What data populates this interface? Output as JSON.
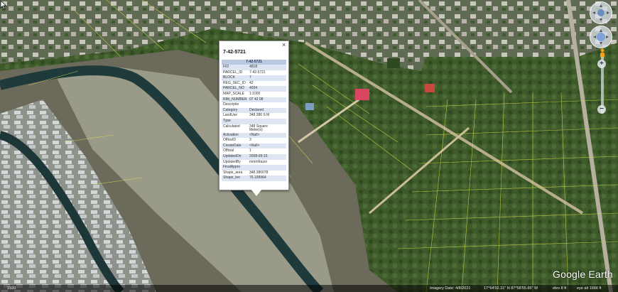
{
  "popup": {
    "title": "7-42-5721",
    "close": "×",
    "header": "7-42-5721",
    "rows": [
      {
        "k": "FID",
        "v": "4818"
      },
      {
        "k": "PARCEL_ID",
        "v": "7-42-5721"
      },
      {
        "k": "BLOCK",
        "v": "7"
      },
      {
        "k": "REG_SEC_ID",
        "v": "42"
      },
      {
        "k": "PARCEL_NO",
        "v": "4034"
      },
      {
        "k": "MAP_SCALE",
        "v": "1:1000"
      },
      {
        "k": "RIM_NUMBER",
        "v": "07 42 08"
      },
      {
        "k": "Descriptio",
        "v": ""
      },
      {
        "k": "Category",
        "v": "Declared"
      },
      {
        "k": "LandUse",
        "v": "348.386 S M"
      },
      {
        "k": "Type",
        "v": ""
      },
      {
        "k": "Calculated",
        "v": "348 Square\nMeter(s)"
      },
      {
        "k": "Activation",
        "v": "<Null>"
      },
      {
        "k": "OfficeID",
        "v": "3"
      },
      {
        "k": "CreateDate",
        "v": "<Null>"
      },
      {
        "k": "Official",
        "v": "1"
      },
      {
        "k": "UpdatedOn",
        "v": "2008-09-15"
      },
      {
        "k": "UpdatedBy",
        "v": "mmmfrazer"
      },
      {
        "k": "FinalAppro",
        "v": ""
      },
      {
        "k": "Shape_area",
        "v": "348.386078"
      },
      {
        "k": "Shape_len",
        "v": "76.199964"
      }
    ]
  },
  "nav": {
    "zoom_in": "+",
    "zoom_out": "−"
  },
  "logo": "Google Earth",
  "status": {
    "scale": "1920",
    "imagery_date": "Imagery Date: 4/8/2021",
    "coords": "17°54'02.31\" N   87°58'55.65\" W",
    "elev": "elev   8 ft",
    "eye_alt": "eye alt   1666 ft"
  },
  "colors": {
    "parcel_line": "#d6e04a",
    "popup_header": "#b9c9e0",
    "row_alt": "#dde5f2"
  }
}
